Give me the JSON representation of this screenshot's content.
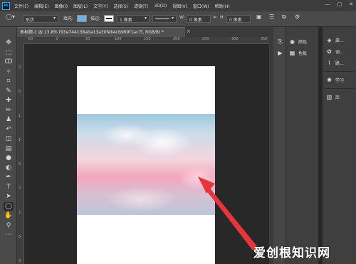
{
  "app": {
    "logo": "Ps"
  },
  "menu": [
    "文件(F)",
    "编辑(E)",
    "图像(I)",
    "图层(L)",
    "文字(Y)",
    "选择(S)",
    "滤镜(T)",
    "3D(D)",
    "视图(V)",
    "窗口(W)",
    "帮助(H)"
  ],
  "window_controls": {
    "minimize": "—",
    "maximize": "□",
    "close": "✕"
  },
  "options": {
    "shape_mode": "形状",
    "fill_label": "填充:",
    "fill_color": "#6fb3e6",
    "stroke_label": "描边:",
    "stroke_width": "1 像素",
    "w_label": "W:",
    "w_value": "0 像素",
    "h_label": "H:",
    "h_value": "0 像素"
  },
  "document_tab": {
    "title": "未标题-1 @ 13.8% (91e744138aba13a30feb4cb999f1ac7f, RGB/8) *",
    "close": "×"
  },
  "rulers": {
    "top": [
      "-50",
      "0",
      "50",
      "100",
      "150",
      "200",
      "250",
      "300",
      "350"
    ],
    "left": [
      "0",
      "5",
      "1",
      "1",
      "5",
      "2",
      "2",
      "5",
      "3"
    ]
  },
  "tools": [
    {
      "name": "move-tool",
      "glyph": "✥"
    },
    {
      "name": "marquee-tool",
      "glyph": "⬚"
    },
    {
      "name": "lasso-tool",
      "glyph": "ↀ"
    },
    {
      "name": "magic-wand-tool",
      "glyph": "✧"
    },
    {
      "name": "crop-tool",
      "glyph": "⌗"
    },
    {
      "name": "eyedropper-tool",
      "glyph": "✎"
    },
    {
      "name": "healing-brush-tool",
      "glyph": "✚"
    },
    {
      "name": "brush-tool",
      "glyph": "✏"
    },
    {
      "name": "clone-stamp-tool",
      "glyph": "♟"
    },
    {
      "name": "history-brush-tool",
      "glyph": "↶"
    },
    {
      "name": "eraser-tool",
      "glyph": "◫"
    },
    {
      "name": "gradient-tool",
      "glyph": "▤"
    },
    {
      "name": "blur-tool",
      "glyph": "●"
    },
    {
      "name": "dodge-tool",
      "glyph": "◐"
    },
    {
      "name": "pen-tool",
      "glyph": "✒"
    },
    {
      "name": "type-tool",
      "glyph": "T"
    },
    {
      "name": "path-selection-tool",
      "glyph": "➤"
    },
    {
      "name": "ellipse-tool",
      "glyph": "◯"
    },
    {
      "name": "hand-tool",
      "glyph": "✋"
    },
    {
      "name": "zoom-tool",
      "glyph": "⚲"
    },
    {
      "name": "more-tools",
      "glyph": "⋯"
    }
  ],
  "panels": {
    "color": "颜色",
    "swatches": "色板",
    "libraries": "库",
    "properties": "属...",
    "adjustments": "调...",
    "paths": "路...",
    "learn": "学习"
  },
  "watermark": "爱创根知识网"
}
